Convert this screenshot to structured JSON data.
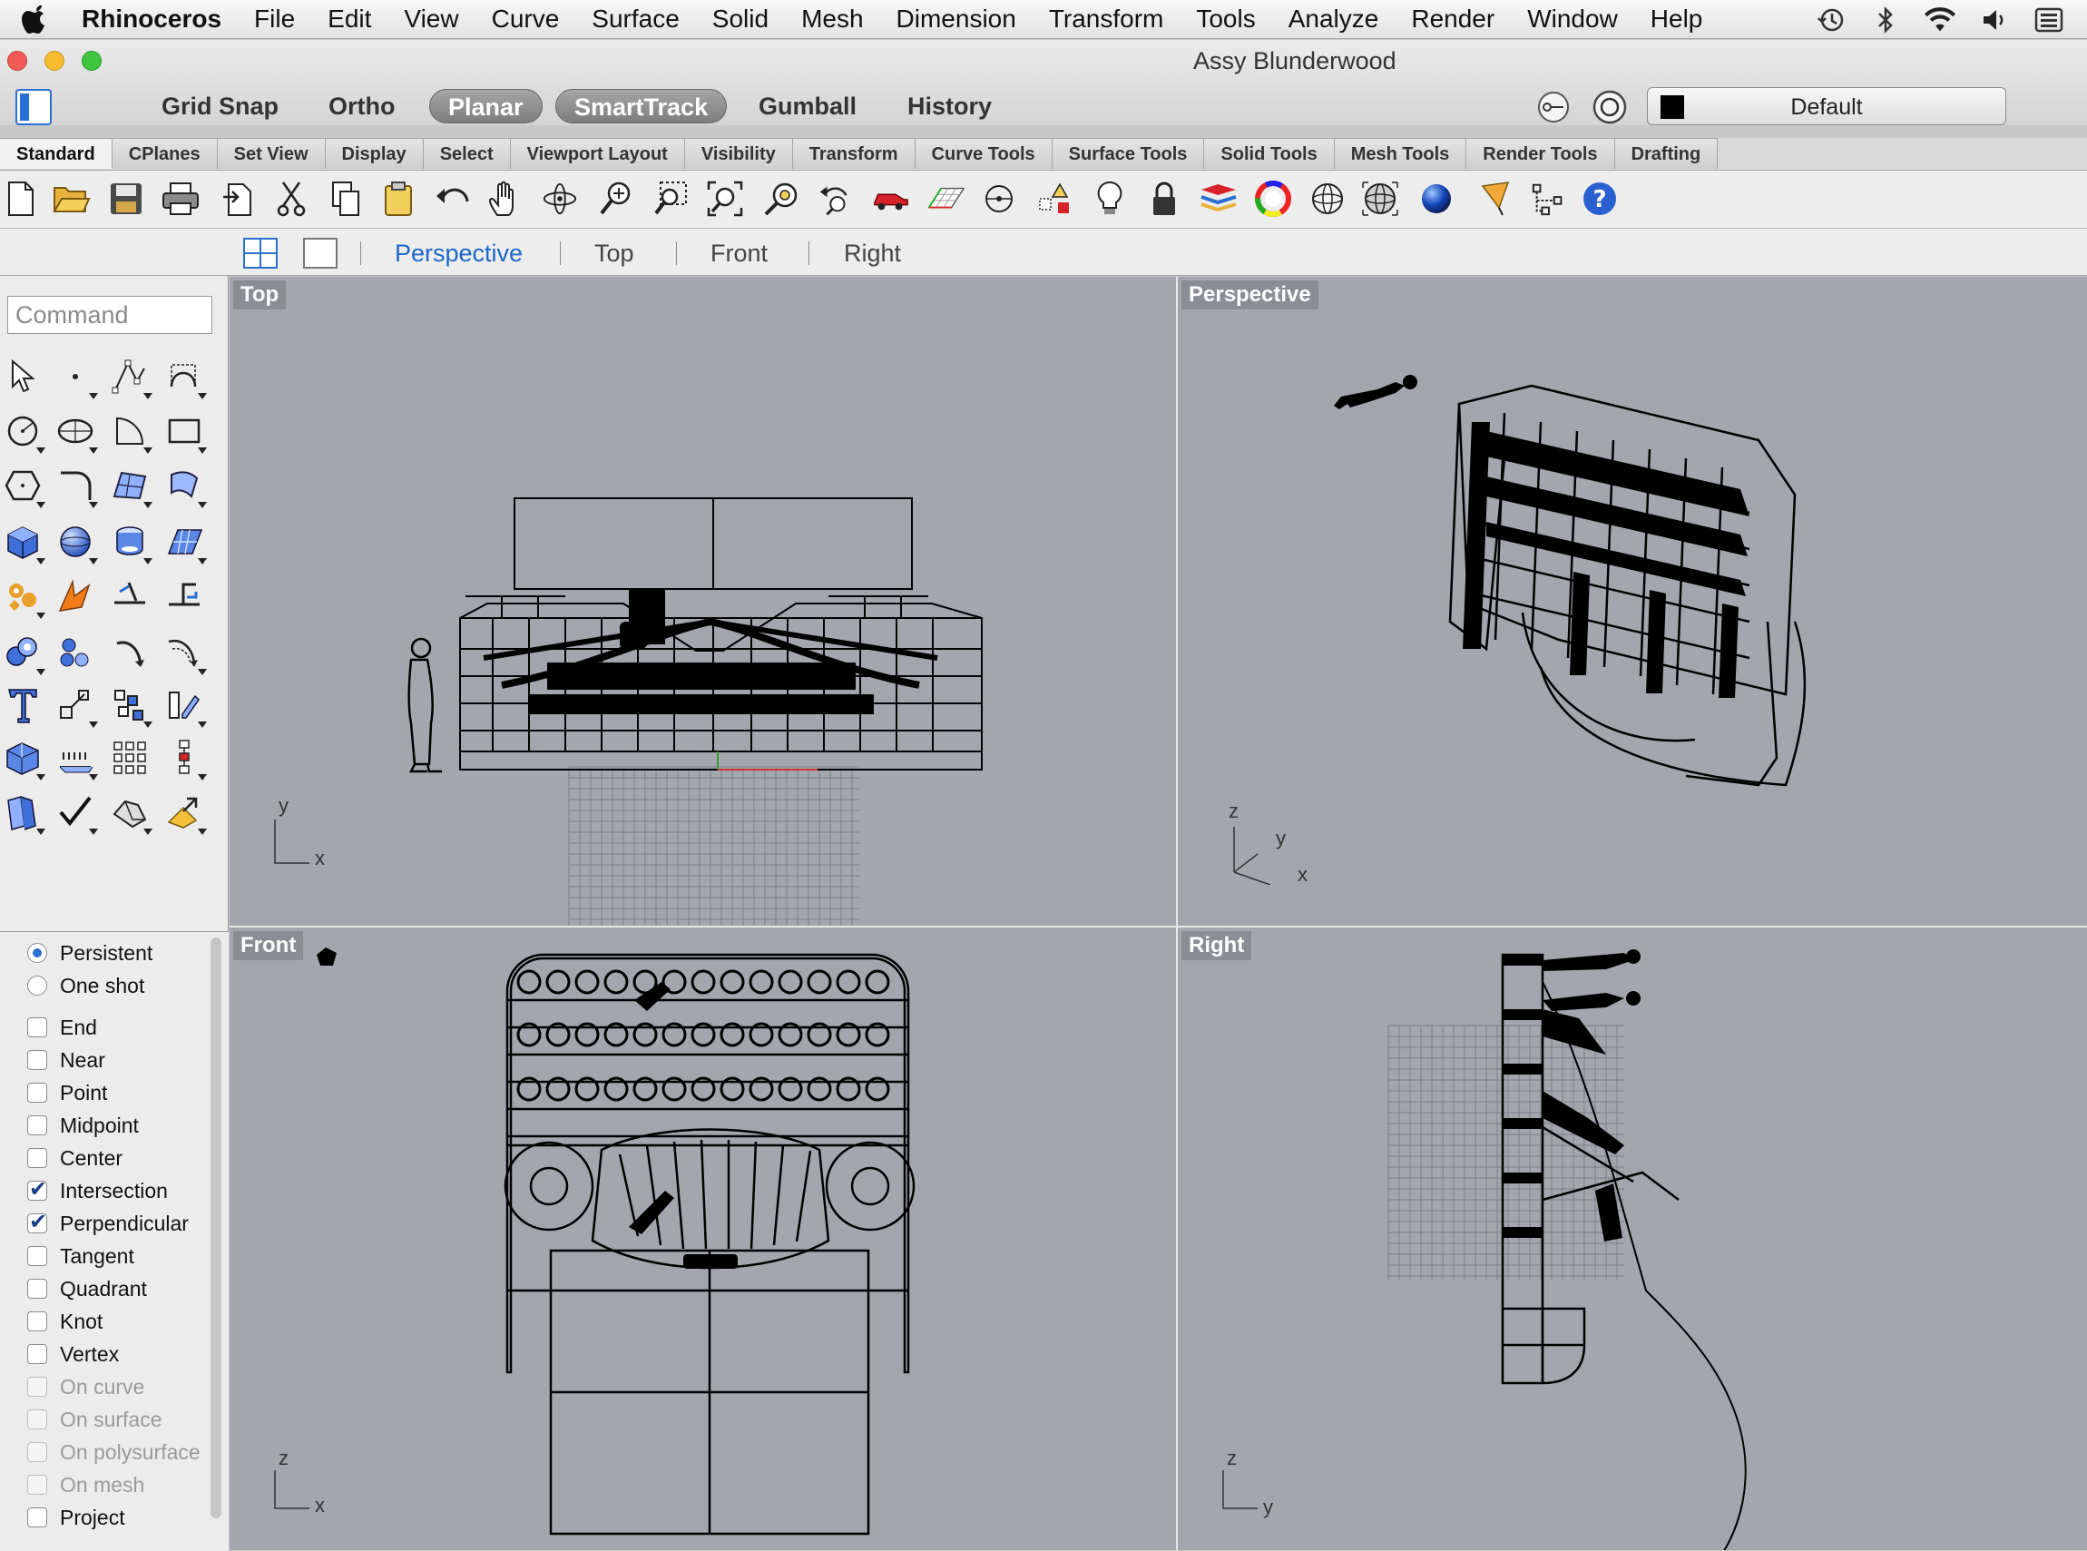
{
  "menubar": {
    "app": "Rhinoceros",
    "items": [
      "File",
      "Edit",
      "View",
      "Curve",
      "Surface",
      "Solid",
      "Mesh",
      "Dimension",
      "Transform",
      "Tools",
      "Analyze",
      "Render",
      "Window",
      "Help"
    ]
  },
  "window": {
    "title": "Assy Blunderwood"
  },
  "modes": {
    "grid_snap": "Grid Snap",
    "ortho": "Ortho",
    "planar": "Planar",
    "smarttrack": "SmartTrack",
    "gumball": "Gumball",
    "history": "History"
  },
  "layer": {
    "name": "Default",
    "swatch_color": "#000000"
  },
  "toolbar_tabs": [
    "Standard",
    "CPlanes",
    "Set View",
    "Display",
    "Select",
    "Viewport Layout",
    "Visibility",
    "Transform",
    "Curve Tools",
    "Surface Tools",
    "Solid Tools",
    "Mesh Tools",
    "Render Tools",
    "Drafting"
  ],
  "viewport_tabs": [
    "Perspective",
    "Top",
    "Front",
    "Right"
  ],
  "command": {
    "placeholder": "Command"
  },
  "osnap": {
    "persistent": "Persistent",
    "one_shot": "One shot",
    "items": [
      {
        "label": "End",
        "checked": false,
        "enabled": true
      },
      {
        "label": "Near",
        "checked": false,
        "enabled": true
      },
      {
        "label": "Point",
        "checked": false,
        "enabled": true
      },
      {
        "label": "Midpoint",
        "checked": false,
        "enabled": true
      },
      {
        "label": "Center",
        "checked": false,
        "enabled": true
      },
      {
        "label": "Intersection",
        "checked": true,
        "enabled": true
      },
      {
        "label": "Perpendicular",
        "checked": true,
        "enabled": true
      },
      {
        "label": "Tangent",
        "checked": false,
        "enabled": true
      },
      {
        "label": "Quadrant",
        "checked": false,
        "enabled": true
      },
      {
        "label": "Knot",
        "checked": false,
        "enabled": true
      },
      {
        "label": "Vertex",
        "checked": false,
        "enabled": true
      },
      {
        "label": "On curve",
        "checked": false,
        "enabled": false
      },
      {
        "label": "On surface",
        "checked": false,
        "enabled": false
      },
      {
        "label": "On polysurface",
        "checked": false,
        "enabled": false
      },
      {
        "label": "On mesh",
        "checked": false,
        "enabled": false
      },
      {
        "label": "Project",
        "checked": false,
        "enabled": true
      }
    ]
  },
  "viewports": {
    "top": {
      "title": "Top",
      "axis_v": "y",
      "axis_h": "x"
    },
    "perspective": {
      "title": "Perspective",
      "axis_v": "z",
      "axis_d": "y",
      "axis_h": "x"
    },
    "front": {
      "title": "Front",
      "axis_v": "z",
      "axis_h": "x"
    },
    "right": {
      "title": "Right",
      "axis_v": "z",
      "axis_h": "y"
    }
  },
  "colors": {
    "viewport_bg": "#a3a7ad",
    "accent_blue": "#1c66c9"
  }
}
